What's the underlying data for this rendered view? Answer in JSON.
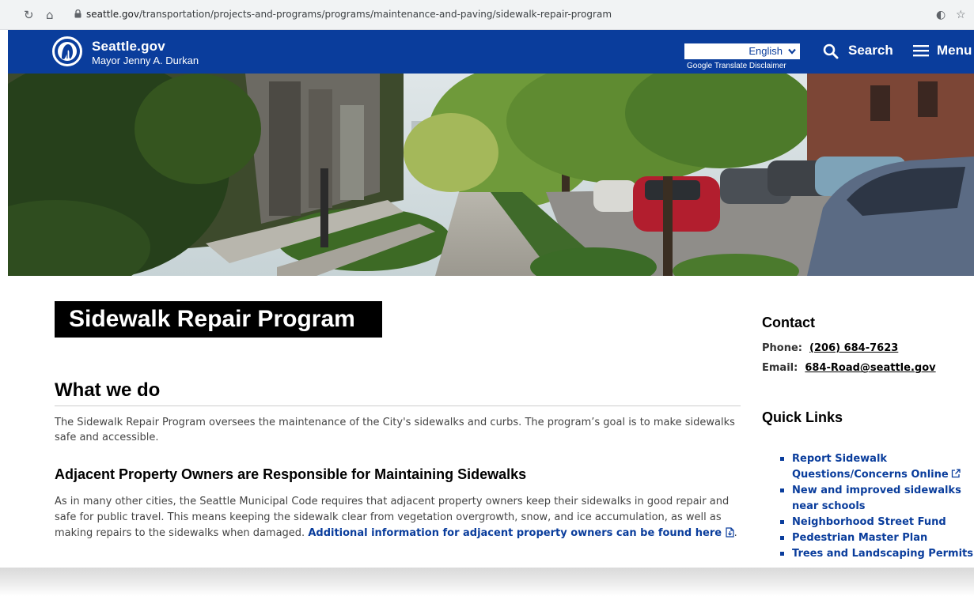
{
  "browser": {
    "url_domain": "seattle.gov",
    "url_path": "/transportation/projects-and-programs/programs/maintenance-and-paving/sidewalk-repair-program"
  },
  "header": {
    "brand_title": "Seattle.gov",
    "brand_subtitle": "Mayor Jenny A. Durkan",
    "language_selected": "English",
    "translate_disclaimer": "Google Translate Disclaimer",
    "search_label": "Search",
    "menu_label": "Menu",
    "color": "#0a3d9c"
  },
  "main": {
    "page_title": "Sidewalk Repair Program",
    "section_heading": "What we do",
    "intro": "The Sidewalk Repair Program oversees the maintenance of the City's sidewalks and curbs. The program’s goal is to make sidewalks safe and accessible.",
    "sub_heading": "Adjacent Property Owners are Responsible for Maintaining Sidewalks",
    "body": "As in many other cities, the Seattle Municipal Code requires that adjacent property owners keep their sidewalks in good repair and safe for public travel. This means keeping the sidewalk clear from vegetation overgrowth, snow, and ice accumulation, as well as making repairs to the sidewalks when damaged.",
    "body_link": "Additional information for adjacent property owners can be found here"
  },
  "sidebar": {
    "contact_heading": "Contact",
    "phone_label": "Phone:",
    "phone": "(206) 684-7623",
    "email_label": "Email:",
    "email": "684-Road@seattle.gov",
    "quick_links_heading": "Quick Links",
    "quick_links": [
      "Report Sidewalk Questions/Concerns Online",
      "New and improved sidewalks near schools",
      "Neighborhood Street Fund",
      "Pedestrian Master Plan",
      "Trees and Landscaping Permits"
    ]
  }
}
